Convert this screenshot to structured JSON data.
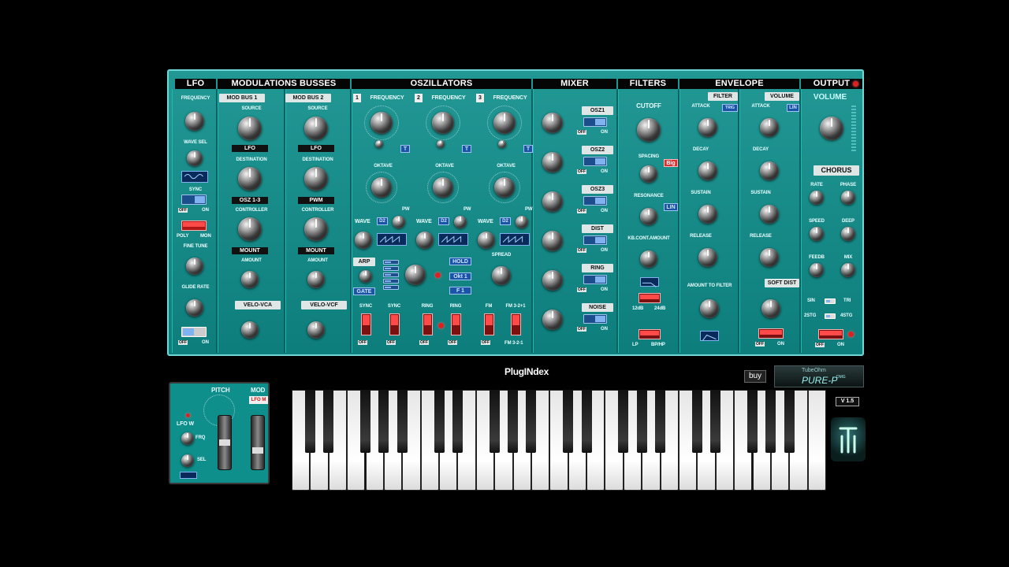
{
  "sections": {
    "lfo": "LFO",
    "modbus": "MODULATIONS BUSSES",
    "osc": "OSZILLATORS",
    "mixer": "MIXER",
    "filters": "FILTERS",
    "envelope": "ENVELOPE",
    "output": "OUTPUT"
  },
  "lfo": {
    "frequency": "FREQUENCY",
    "wave_sel": "WAVE SEL",
    "sync": "SYNC",
    "off": "OFF",
    "on": "ON",
    "poly": "POLY",
    "mon": "MON",
    "fine_tune": "FINE TUNE",
    "glide_rate": "GLIDE RATE"
  },
  "modbus": [
    {
      "title": "MOD BUS 1",
      "source_label": "SOURCE",
      "source": "LFO",
      "dest_label": "DESTINATION",
      "dest": "OSZ 1-3",
      "ctrl_label": "CONTROLLER",
      "ctrl": "MOUNT",
      "amount": "AMOUNT",
      "velo": "VELO-VCA"
    },
    {
      "title": "MOD BUS 2",
      "source_label": "SOURCE",
      "source": "LFO",
      "dest_label": "DESTINATION",
      "dest": "PWM",
      "ctrl_label": "CONTROLLER",
      "ctrl": "MOUNT",
      "amount": "AMOUNT",
      "velo": "VELO-VCF"
    }
  ],
  "osc": {
    "units": [
      {
        "num": "1",
        "freq": "FREQUENCY",
        "octave": "OKTAVE",
        "wave": "WAVE",
        "wave_val": "D2",
        "pw": "PW"
      },
      {
        "num": "2",
        "freq": "FREQUENCY",
        "octave": "OKTAVE",
        "wave": "WAVE",
        "wave_val": "D2",
        "pw": "PW"
      },
      {
        "num": "3",
        "freq": "FREQUENCY",
        "octave": "OKTAVE",
        "wave": "WAVE",
        "wave_val": "D2",
        "pw": "PW"
      }
    ],
    "arp": "ARP",
    "gate": "GATE",
    "hold": "HOLD",
    "oct1": "Okt 1",
    "f1": "F 1",
    "spread": "SPREAD",
    "bottom": [
      "SYNC",
      "SYNC",
      "RING",
      "RING",
      "FM",
      "FM 3-2+1"
    ],
    "fm321": "FM 3-2-1",
    "off": "OFF"
  },
  "mixer": {
    "channels": [
      "OSZ1",
      "OSZ2",
      "OSZ3",
      "DIST",
      "RING",
      "NOISE"
    ],
    "off": "OFF",
    "on": "ON"
  },
  "filters": {
    "cutoff": "CUTOFF",
    "spacing": "SPACING",
    "big": "Big",
    "resonance": "RESONANCE",
    "lin": "LIN",
    "kb": "KB.CONT.AMOUNT",
    "db12": "12dB",
    "db24": "24dB",
    "lp": "LP",
    "bp": "BP/HP"
  },
  "envelope": {
    "filter": "FILTER",
    "volume": "VOLUME",
    "attack": "ATTACK",
    "decay": "DECAY",
    "sustain": "SUSTAIN",
    "release": "RELEASE",
    "amount": "AMOUNT TO FILTER",
    "trig": "TRIG",
    "lin": "LIN",
    "soft_dist": "SOFT DIST",
    "off": "OFF",
    "on": "ON"
  },
  "output": {
    "volume": "VOLUME",
    "chorus": "CHORUS",
    "rate": "RATE",
    "phase": "PHASE",
    "speed": "SPEED",
    "deep": "DEEP",
    "feedb": "FEEDB",
    "mix": "MIX",
    "sin": "SIN",
    "tri": "TRI",
    "stg2": "2STG",
    "stg4": "4STG",
    "off": "OFF",
    "on": "ON"
  },
  "brand": {
    "logo": "PlugINdex",
    "buy": "buy",
    "product_top": "TubeOhm",
    "product": "PURE-P",
    "product_sub": "DMG",
    "version": "V 1.5"
  },
  "pitch": {
    "pitch": "PITCH",
    "mod": "MOD",
    "lfo_w": "LFO W",
    "lfo_m": "LFO M",
    "frq": "FRQ",
    "sel": "SEL"
  },
  "keyboard": {
    "white_keys": 29
  }
}
